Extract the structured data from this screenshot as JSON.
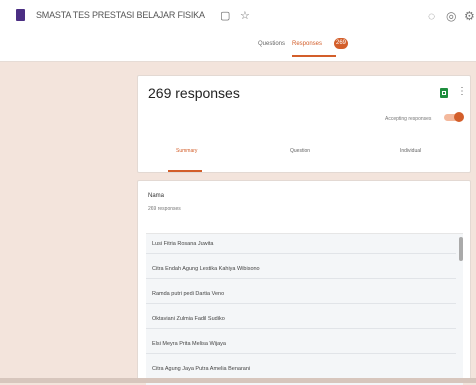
{
  "app": {
    "title": "SMASTA TES PRESTASI BELAJAR FISIKA",
    "folder_icon": "folder-icon",
    "star_icon": "star-icon"
  },
  "top_icons": [
    "palette-icon",
    "eye-icon",
    "settings-icon"
  ],
  "tabs": {
    "questions": "Questions",
    "responses": "Responses",
    "responses_badge": "269"
  },
  "summary": {
    "count_label": "269 responses",
    "accepting_label": "Accepting responses",
    "subtabs": [
      "Summary",
      "Question",
      "Individual"
    ]
  },
  "question": {
    "label": "Nama",
    "count": "269 responses",
    "answers": [
      "Lusi Fitria Rosana Juwita",
      "Citra Endah Agung Lestika Kahiya Wibisono",
      "Ramda putri pedi Dartia Veno",
      "Oktaviani Zulmia Fadil Sudiko",
      "Elsi Meyra Prita Melisa Wijaya",
      "Citra Agung Jaya Putra Amelia Benarani"
    ]
  },
  "colors": {
    "accent": "#d35e2a",
    "background": "#f3e4dc",
    "sheets": "#1e8e3e",
    "doc_icon": "#4b2e83"
  }
}
